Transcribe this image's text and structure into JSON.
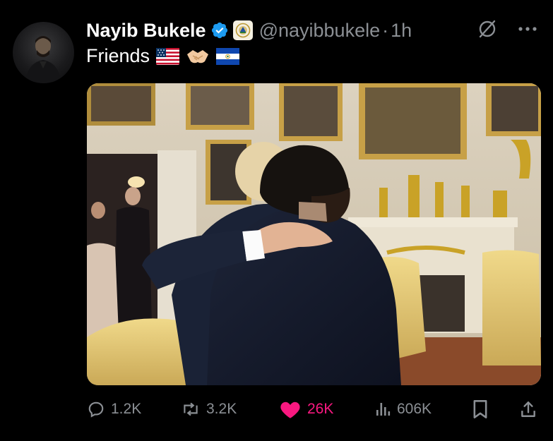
{
  "author": {
    "name": "Nayib Bukele",
    "handle": "@nayibbukele",
    "separator": "·",
    "time": "1h"
  },
  "tweet": {
    "text": "Friends",
    "emojis": [
      "us-flag-emoji",
      "handshake-emoji",
      "el-salvador-flag-emoji"
    ]
  },
  "actions": {
    "replies": "1.2K",
    "reposts": "3.2K",
    "likes": "26K",
    "views": "606K"
  },
  "colors": {
    "background": "#000000",
    "text": "#e7e9ea",
    "muted": "#8b8f94",
    "like": "#f91880",
    "verified": "#1d9bf0"
  },
  "icons": {
    "header": [
      "verified-badge-icon",
      "government-seal-icon",
      "grok-icon",
      "more-icon"
    ],
    "actions": [
      "reply-icon",
      "repost-icon",
      "heart-icon",
      "views-icon",
      "bookmark-icon",
      "share-icon"
    ]
  }
}
